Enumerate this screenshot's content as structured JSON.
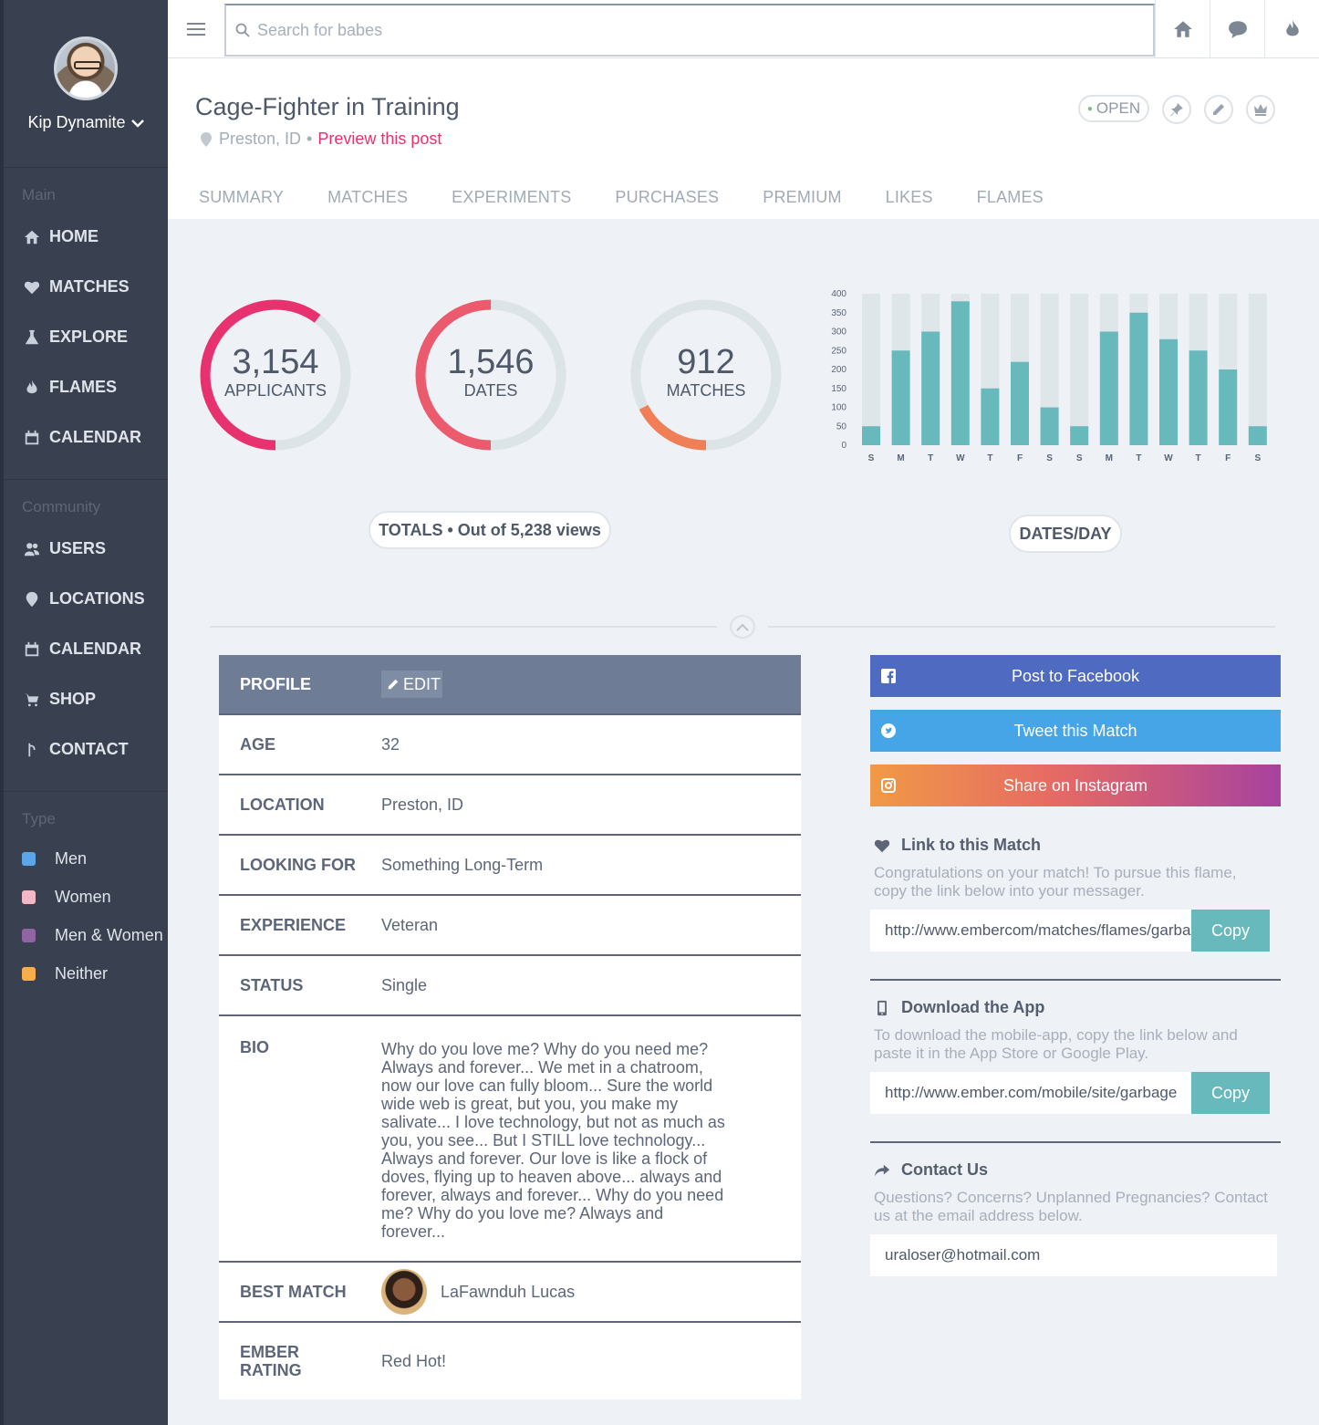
{
  "sidebar": {
    "user_name": "Kip Dynamite",
    "sections": [
      {
        "heading": "Main",
        "items": [
          {
            "label": "HOME",
            "icon": "home-icon"
          },
          {
            "label": "MATCHES",
            "icon": "heart-icon"
          },
          {
            "label": "EXPLORE",
            "icon": "flask-icon"
          },
          {
            "label": "FLAMES",
            "icon": "flame-icon"
          },
          {
            "label": "CALENDAR",
            "icon": "calendar-icon"
          }
        ]
      },
      {
        "heading": "Community",
        "items": [
          {
            "label": "USERS",
            "icon": "users-icon"
          },
          {
            "label": "LOCATIONS",
            "icon": "location-pin-icon"
          },
          {
            "label": "CALENDAR",
            "icon": "calendar-icon"
          },
          {
            "label": "SHOP",
            "icon": "cart-icon"
          },
          {
            "label": "CONTACT",
            "icon": "branch-icon"
          }
        ]
      }
    ],
    "type_heading": "Type",
    "types": [
      {
        "label": "Men",
        "color": "#5aa6e8"
      },
      {
        "label": "Women",
        "color": "#f4b8c4"
      },
      {
        "label": "Men & Women",
        "color": "#9065a2"
      },
      {
        "label": "Neither",
        "color": "#f6ad4c"
      }
    ]
  },
  "topbar": {
    "search_placeholder": "Search for babes"
  },
  "header": {
    "title": "Cage-Fighter in Training",
    "location": "Preston, ID",
    "separator": "•",
    "preview_link": "Preview this post",
    "status_badge": "OPEN",
    "tabs": [
      "SUMMARY",
      "MATCHES",
      "EXPERIMENTS",
      "PURCHASES",
      "PREMIUM",
      "LIKES",
      "FLAMES"
    ]
  },
  "stats": {
    "rings": [
      {
        "value": "3,154",
        "label": "APPLICANTS",
        "fraction": 0.602,
        "color": "#e8326f"
      },
      {
        "value": "1,546",
        "label": "DATES",
        "fraction": 0.5,
        "color": "#ec5a6e"
      },
      {
        "value": "912",
        "label": "MATCHES",
        "fraction": 0.174,
        "color": "#f07f58"
      }
    ],
    "totals_label": "TOTALS",
    "totals_sep": "•",
    "totals_text": "Out of 5,238 views",
    "chart_caption": "DATES/DAY"
  },
  "chart_data": {
    "type": "bar",
    "categories": [
      "S",
      "M",
      "T",
      "W",
      "T",
      "F",
      "S",
      "S",
      "M",
      "T",
      "W",
      "T",
      "F",
      "S"
    ],
    "values": [
      50,
      250,
      300,
      380,
      150,
      220,
      100,
      50,
      300,
      350,
      280,
      250,
      200,
      50
    ],
    "ylim": [
      0,
      400
    ],
    "yticks": [
      0,
      50,
      100,
      150,
      200,
      250,
      300,
      350,
      400
    ],
    "bar_color": "#67b9bc",
    "track_color": "#dfe6ea",
    "grid": false
  },
  "profile": {
    "header_label": "PROFILE",
    "edit_label": "EDIT",
    "rows": [
      {
        "label": "AGE",
        "value": "32"
      },
      {
        "label": "LOCATION",
        "value": "Preston, ID"
      },
      {
        "label": "LOOKING FOR",
        "value": "Something Long-Term"
      },
      {
        "label": "EXPERIENCE",
        "value": "Veteran"
      },
      {
        "label": "STATUS",
        "value": "Single"
      },
      {
        "label": "BIO",
        "value": "Why do you love me? Why do you need me? Always and forever... We met in a chatroom, now our love can fully bloom... Sure the world wide web is great, but you, you make my salivate... I love technology, but not as much as you, you see... But I STILL love technology... Always and forever. Our love is like a flock of doves, flying up to heaven above... always and forever, always and forever... Why do you need me? Why do you love me? Always and forever..."
      },
      {
        "label": "BEST MATCH",
        "value": "LaFawnduh Lucas"
      },
      {
        "label": "EMBER RATING",
        "value": "Red Hot!"
      }
    ]
  },
  "share": {
    "facebook": {
      "label": "Post to Facebook",
      "color": "#4e6ac1"
    },
    "twitter": {
      "label": "Tweet this Match",
      "color": "#46a5e6"
    },
    "instagram": {
      "label": "Share on Instagram"
    }
  },
  "link_section": {
    "title": "Link to this Match",
    "text": "Congratulations on your match! To pursue this flame, copy the link below into your messager.",
    "url": "http://www.embercom/matches/flames/garbage",
    "copy_label": "Copy"
  },
  "app_section": {
    "title": "Download the App",
    "text": "To download the mobile-app, copy the link below and paste it in the App Store or Google Play.",
    "url": "http://www.ember.com/mobile/site/garbage",
    "copy_label": "Copy"
  },
  "contact_section": {
    "title": "Contact Us",
    "text": "Questions? Concerns? Unplanned Pregnancies? Contact us at the email address below.",
    "email": "uraloser@hotmail.com"
  }
}
